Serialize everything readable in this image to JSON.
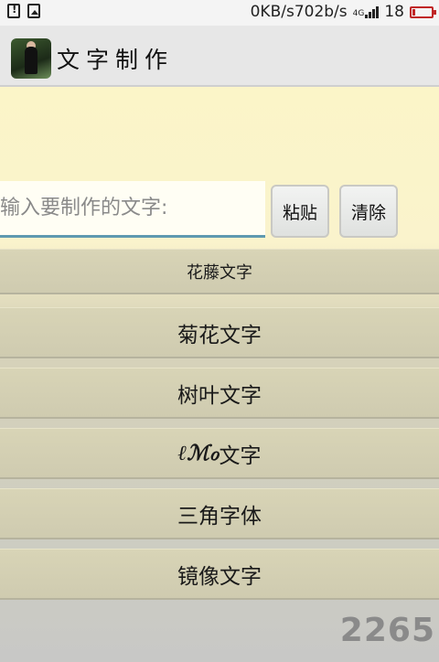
{
  "status_bar": {
    "net_speed": "0KB/s702b/s",
    "network_type": "4G",
    "battery_level": "18",
    "battery_color": "#c02626"
  },
  "action_bar": {
    "title": "文字制作",
    "app_icon": "app-photo-icon"
  },
  "input": {
    "placeholder": "输入要制作的文字:",
    "value": ""
  },
  "buttons": {
    "paste": "粘贴",
    "clear": "清除"
  },
  "options": [
    {
      "label": "花藤文字"
    },
    {
      "label": "菊花文字"
    },
    {
      "label": "树叶文字"
    },
    {
      "prefix": "ℓℳℴ",
      "label": "文字"
    },
    {
      "label": "三角字体"
    },
    {
      "label": "镜像文字"
    }
  ],
  "watermark": "2265",
  "colors": {
    "content_bg": "#faf3cc",
    "input_underline": "#5f9ab0"
  }
}
